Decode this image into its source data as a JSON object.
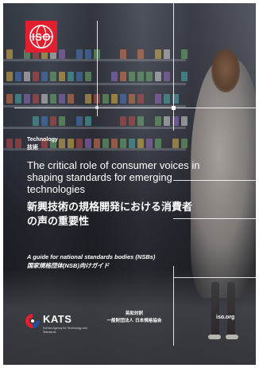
{
  "cover": {
    "category_en": "Technology",
    "category_ja": "技術",
    "title_en": "The critical role of consumer voices in shaping standards for emerging technologies",
    "title_ja": "新興技術の規格開発における消費者の声の重要性",
    "subtitle_en": "A guide for national standards bodies (NSBs)",
    "subtitle_ja": "国家規格団体(NSB)向けガイド"
  },
  "logos": {
    "iso": {
      "text": "ISO",
      "color": "#e11f2f",
      "icon": "iso-globe-logo"
    },
    "kats": {
      "name": "KATS",
      "tagline": "Korean Agency for Technology and Standards",
      "icon": "kats-swirl-logo",
      "colors": [
        "#e11f2f",
        "#1f4fa3"
      ]
    }
  },
  "footer": {
    "publisher_line1": "英和対訳",
    "publisher_line2": "一般財団法人 日本規格協会",
    "website": "iso.org"
  }
}
